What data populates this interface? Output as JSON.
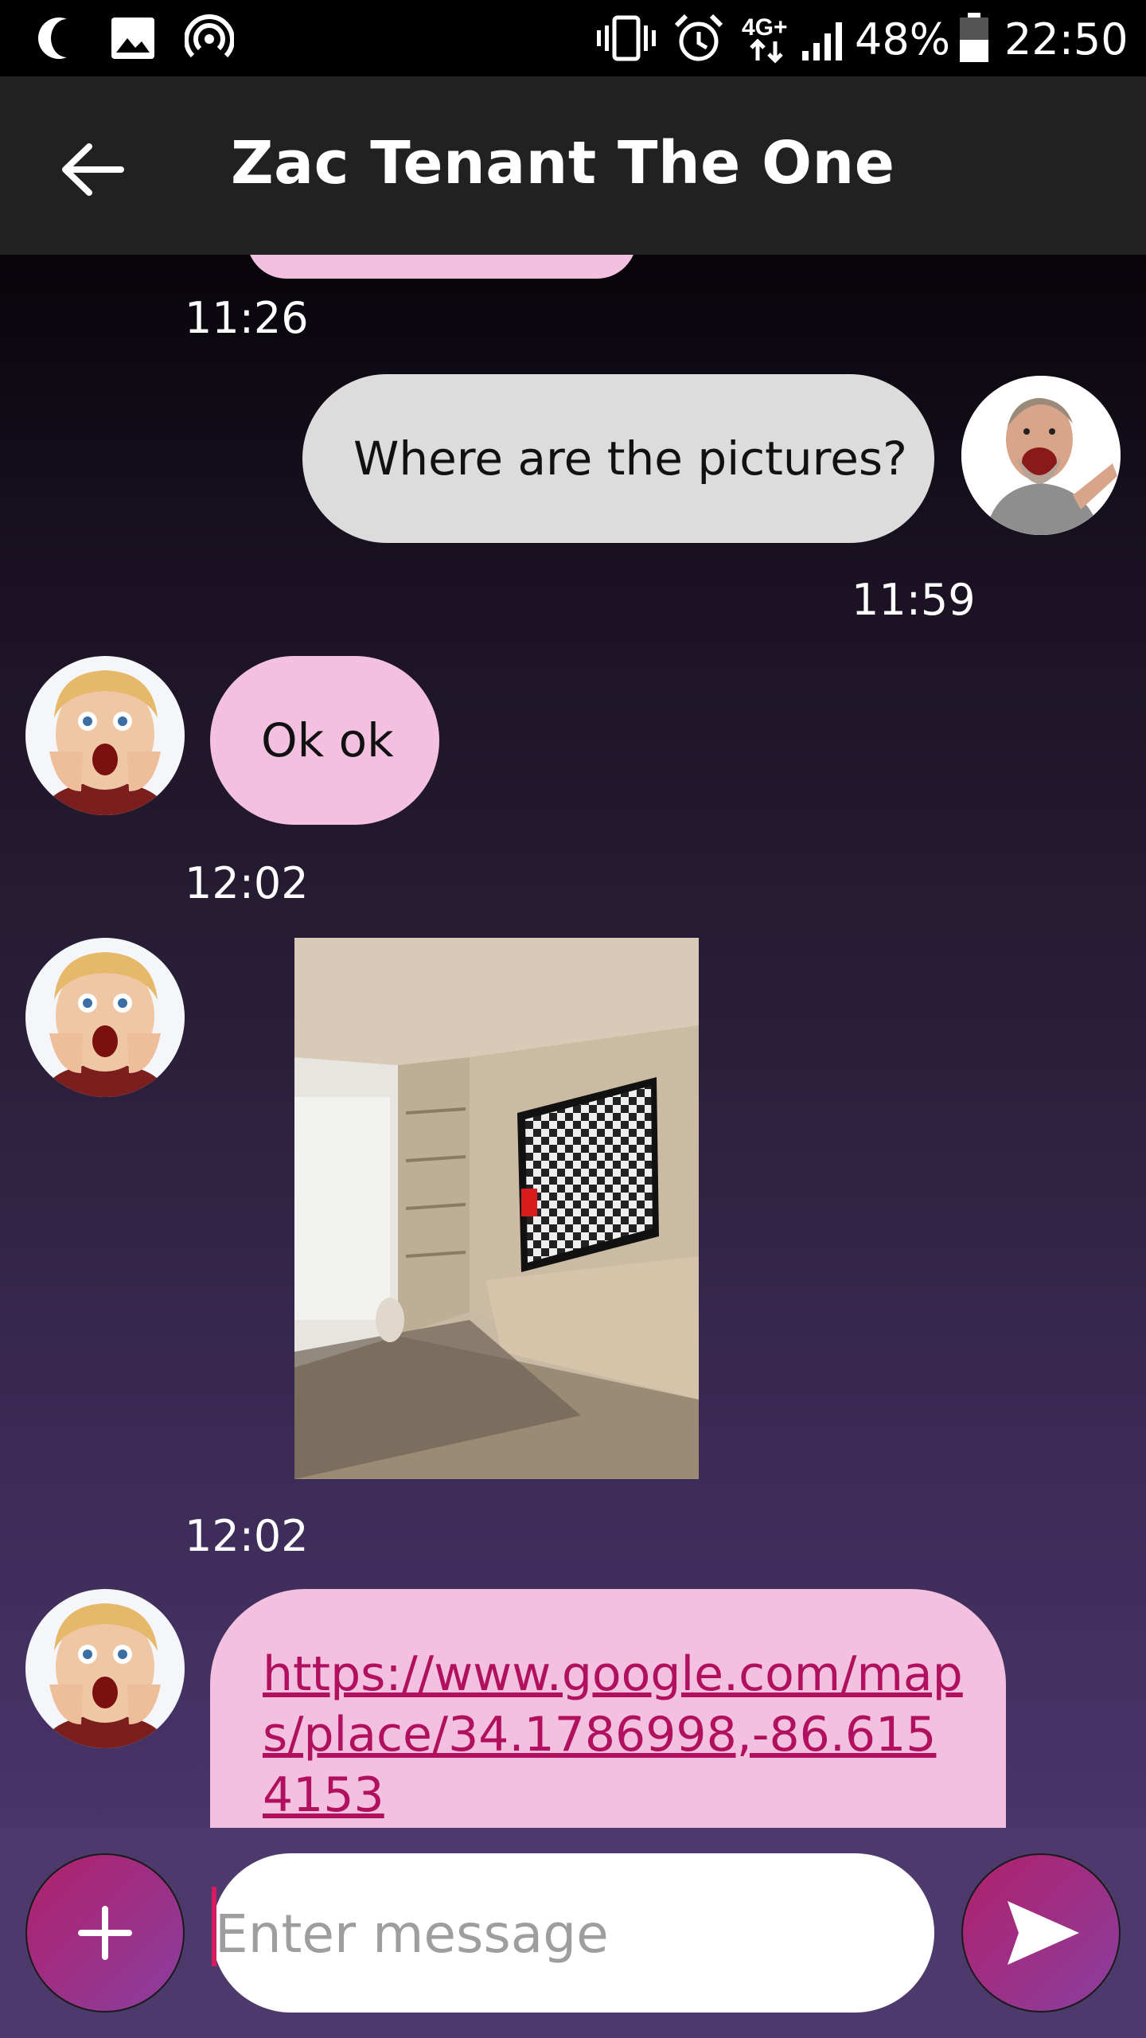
{
  "status_bar": {
    "battery": "48%",
    "time": "22:50",
    "network": "4G+",
    "icons": [
      "moon-icon",
      "image-icon",
      "hotspot-icon",
      "vibrate-icon",
      "alarm-icon",
      "network-4g-icon",
      "signal-icon",
      "battery-icon"
    ]
  },
  "app_bar": {
    "title": "Zac Tenant The One",
    "back_icon": "back-arrow-icon"
  },
  "messages": [
    {
      "time": "11:26"
    },
    {
      "direction": "outgoing",
      "text": "Where are the pictures?",
      "time": "11:59"
    },
    {
      "direction": "incoming",
      "text": "Ok ok",
      "time": "12:02"
    },
    {
      "direction": "incoming",
      "type": "image",
      "time": "12:02"
    },
    {
      "direction": "incoming",
      "type": "link",
      "text": "https://www.google.com/maps/place/34.1786998,-86.6154153"
    }
  ],
  "composer": {
    "placeholder": "Enter message",
    "add_icon": "plus-icon",
    "send_icon": "send-icon"
  },
  "colors": {
    "incoming_bubble": "#f4c0e0",
    "outgoing_bubble": "#dcdcdc",
    "app_bar": "#212121",
    "link": "#b0105e",
    "fab_start": "#b0206a",
    "fab_end": "#8a3fa0"
  }
}
